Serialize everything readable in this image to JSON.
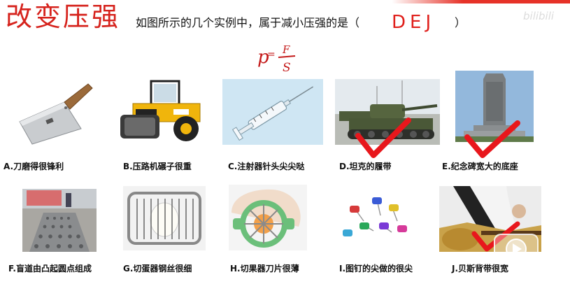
{
  "title": "改变压强",
  "question_text": "如图所示的几个实例中，属于减小压强的是（",
  "answer": "DEJ",
  "question_close": "）",
  "formula": {
    "lhs": "p",
    "eq": "=",
    "num": "F",
    "den": "S"
  },
  "watermark": "bilibili",
  "items": [
    {
      "label": "A.刀磨得很锋利",
      "icon": "cleaver-knife",
      "checked": false
    },
    {
      "label": "B.压路机碾子很重",
      "icon": "road-roller",
      "checked": false
    },
    {
      "label": "C.注射器针头尖尖哒",
      "icon": "syringe",
      "checked": false
    },
    {
      "label": "D.坦克的履带",
      "icon": "tank",
      "checked": true
    },
    {
      "label": "E.纪念碑宽大的底座",
      "icon": "monument",
      "checked": true
    },
    {
      "label": "F.盲道由凸起圆点组成",
      "icon": "tactile-paving",
      "checked": false
    },
    {
      "label": "G.切蛋器钢丝很细",
      "icon": "egg-slicer",
      "checked": false
    },
    {
      "label": "H.切果器刀片很薄",
      "icon": "apple-slicer",
      "checked": false
    },
    {
      "label": "I.图钉的尖做的很尖",
      "icon": "push-pins",
      "checked": false
    },
    {
      "label": "J.贝斯背带很宽",
      "icon": "bass-strap",
      "checked": true
    }
  ],
  "colors": {
    "title": "#d6231d",
    "answer": "#e0201c",
    "check": "#e8171c"
  }
}
